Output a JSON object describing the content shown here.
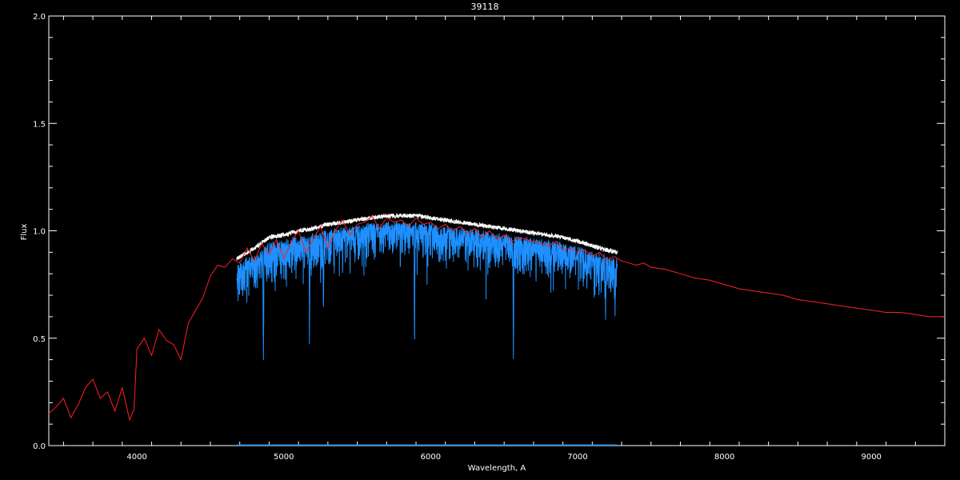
{
  "chart_data": {
    "type": "line",
    "title": "39118",
    "xlabel": "Wavelength, A",
    "ylabel": "Flux",
    "xlim": [
      3400,
      9500
    ],
    "ylim": [
      0.0,
      2.0
    ],
    "x_ticks": [
      4000,
      5000,
      6000,
      7000,
      8000,
      9000
    ],
    "y_ticks": [
      0.0,
      0.5,
      1.0,
      1.5,
      2.0
    ],
    "x_tick_labels": [
      "4000",
      "5000",
      "6000",
      "7000",
      "8000",
      "9000"
    ],
    "y_tick_labels": [
      "0.0",
      "0.5",
      "1.0",
      "1.5",
      "2.0"
    ],
    "grid": false,
    "colors": {
      "background": "#000000",
      "axes": "#ffffff",
      "model": "#ff2020",
      "observed": "#1e90ff",
      "observed_shadow": "#ffffff",
      "error": "#1e90ff"
    },
    "series": [
      {
        "color": "#ff2020",
        "x": [
          3400,
          3450,
          3500,
          3550,
          3600,
          3650,
          3700,
          3750,
          3800,
          3850,
          3900,
          3950,
          3980,
          4000,
          4050,
          4100,
          4150,
          4200,
          4250,
          4300,
          4350,
          4400,
          4450,
          4500,
          4550,
          4600,
          4650,
          4700,
          4750,
          4800,
          4850,
          4900,
          4950,
          5000,
          5050,
          5100,
          5150,
          5200,
          5250,
          5300,
          5350,
          5400,
          5450,
          5500,
          5550,
          5600,
          5650,
          5700,
          5750,
          5800,
          5850,
          5900,
          5950,
          6000,
          6050,
          6100,
          6150,
          6200,
          6250,
          6300,
          6350,
          6400,
          6450,
          6500,
          6550,
          6600,
          6650,
          6700,
          6750,
          6800,
          6850,
          6900,
          6950,
          7000,
          7050,
          7100,
          7150,
          7200,
          7250,
          7300,
          7350,
          7400,
          7450,
          7500,
          7600,
          7700,
          7800,
          7900,
          8000,
          8100,
          8200,
          8300,
          8400,
          8500,
          8600,
          8700,
          8800,
          8900,
          9000,
          9100,
          9200,
          9300,
          9400,
          9500
        ],
        "y": [
          0.15,
          0.18,
          0.22,
          0.13,
          0.19,
          0.27,
          0.31,
          0.22,
          0.25,
          0.16,
          0.27,
          0.12,
          0.17,
          0.45,
          0.5,
          0.42,
          0.54,
          0.49,
          0.47,
          0.4,
          0.57,
          0.63,
          0.69,
          0.79,
          0.84,
          0.83,
          0.87,
          0.85,
          0.92,
          0.86,
          0.94,
          0.89,
          0.96,
          0.87,
          0.95,
          1.0,
          0.9,
          0.96,
          1.02,
          0.92,
          1.0,
          1.05,
          0.98,
          1.03,
          1.04,
          1.07,
          1.01,
          1.06,
          1.04,
          1.05,
          1.02,
          1.06,
          1.03,
          1.04,
          1.01,
          1.03,
          1.0,
          1.02,
          0.99,
          1.01,
          0.97,
          1.0,
          0.96,
          0.98,
          0.95,
          0.97,
          0.96,
          0.95,
          0.94,
          0.93,
          0.95,
          0.91,
          0.92,
          0.9,
          0.91,
          0.88,
          0.9,
          0.86,
          0.88,
          0.86,
          0.85,
          0.84,
          0.85,
          0.83,
          0.82,
          0.8,
          0.78,
          0.77,
          0.75,
          0.73,
          0.72,
          0.71,
          0.7,
          0.68,
          0.67,
          0.66,
          0.65,
          0.64,
          0.63,
          0.62,
          0.62,
          0.61,
          0.6,
          0.6
        ]
      },
      {
        "color": "#1e90ff",
        "x_range": [
          4680,
          7270
        ],
        "continuum": [
          [
            4680,
            0.84
          ],
          [
            4800,
            0.89
          ],
          [
            4900,
            0.94
          ],
          [
            5000,
            0.95
          ],
          [
            5100,
            0.97
          ],
          [
            5200,
            0.98
          ],
          [
            5300,
            1.0
          ],
          [
            5400,
            1.01
          ],
          [
            5500,
            1.02
          ],
          [
            5600,
            1.03
          ],
          [
            5700,
            1.04
          ],
          [
            5800,
            1.04
          ],
          [
            5900,
            1.04
          ],
          [
            6000,
            1.03
          ],
          [
            6100,
            1.02
          ],
          [
            6200,
            1.01
          ],
          [
            6300,
            1.0
          ],
          [
            6400,
            0.99
          ],
          [
            6500,
            0.98
          ],
          [
            6600,
            0.97
          ],
          [
            6700,
            0.96
          ],
          [
            6800,
            0.95
          ],
          [
            6900,
            0.94
          ],
          [
            7000,
            0.92
          ],
          [
            7100,
            0.9
          ],
          [
            7200,
            0.88
          ],
          [
            7270,
            0.87
          ]
        ],
        "absorption_lines": [
          [
            4861,
            0.37
          ],
          [
            5175,
            0.55
          ],
          [
            5270,
            0.62
          ],
          [
            5890,
            0.47
          ],
          [
            6563,
            0.38
          ],
          [
            7190,
            0.65
          ],
          [
            7255,
            0.64
          ]
        ]
      },
      {
        "color": "#1e90ff",
        "x_range": [
          4680,
          7270
        ],
        "y_level": 0.003
      }
    ]
  }
}
